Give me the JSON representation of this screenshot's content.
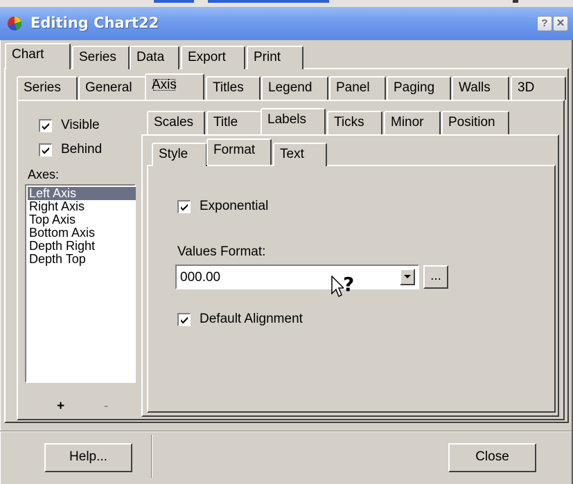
{
  "window": {
    "title": "Editing Chart22",
    "help_glyph": "?",
    "close_glyph": "✕"
  },
  "tabs_main": [
    {
      "label": "Chart",
      "selected": true
    },
    {
      "label": "Series",
      "selected": false
    },
    {
      "label": "Data",
      "selected": false
    },
    {
      "label": "Export",
      "selected": false
    },
    {
      "label": "Print",
      "selected": false
    }
  ],
  "tabs_chart": [
    {
      "label": "Series",
      "selected": false
    },
    {
      "label": "General",
      "selected": false
    },
    {
      "label": "Axis",
      "selected": true
    },
    {
      "label": "Titles",
      "selected": false
    },
    {
      "label": "Legend",
      "selected": false
    },
    {
      "label": "Panel",
      "selected": false
    },
    {
      "label": "Paging",
      "selected": false
    },
    {
      "label": "Walls",
      "selected": false
    },
    {
      "label": "3D",
      "selected": false
    }
  ],
  "left_panel": {
    "visible": {
      "label": "Visible",
      "checked": true
    },
    "behind": {
      "label": "Behind",
      "checked": true
    },
    "axes_label": "Axes:",
    "axes": [
      "Left Axis",
      "Right Axis",
      "Top Axis",
      "Bottom Axis",
      "Depth Right",
      "Depth Top"
    ],
    "selected_axis": "Left Axis",
    "add_label": "+",
    "remove_label": "-"
  },
  "tabs_axis": [
    {
      "label": "Scales",
      "selected": false
    },
    {
      "label": "Title",
      "selected": false
    },
    {
      "label": "Labels",
      "selected": true
    },
    {
      "label": "Ticks",
      "selected": false
    },
    {
      "label": "Minor",
      "selected": false
    },
    {
      "label": "Position",
      "selected": false
    }
  ],
  "tabs_labels": [
    {
      "label": "Style",
      "selected": false
    },
    {
      "label": "Format",
      "selected": true
    },
    {
      "label": "Text",
      "selected": false
    }
  ],
  "format": {
    "exponential": {
      "label": "Exponential",
      "checked": true
    },
    "values_format_label": "Values Format:",
    "values_format_value": "000.00",
    "ellipsis_label": "...",
    "default_alignment": {
      "label": "Default Alignment",
      "checked": true
    },
    "cursor_glyph": "?"
  },
  "footer": {
    "help_label": "Help...",
    "close_label": "Close"
  },
  "colors": {
    "titlebar": "#6f9bee",
    "dialog_bg": "#d4d0c8",
    "list_selection": "#6b7185"
  }
}
